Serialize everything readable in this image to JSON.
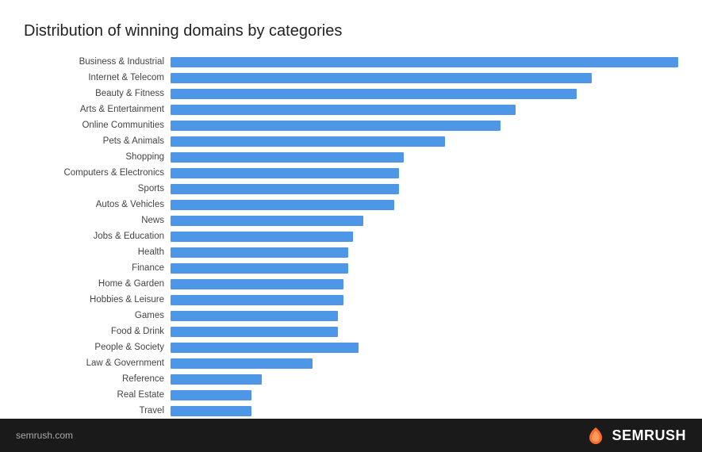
{
  "title": "Distribution of winning domains by categories",
  "footer": {
    "url": "semrush.com",
    "brand": "SEMRUSH"
  },
  "bars": [
    {
      "label": "Business & Industrial",
      "value": 100
    },
    {
      "label": "Internet & Telecom",
      "value": 83
    },
    {
      "label": "Beauty & Fitness",
      "value": 80
    },
    {
      "label": "Arts & Entertainment",
      "value": 68
    },
    {
      "label": "Online Communities",
      "value": 65
    },
    {
      "label": "Pets & Animals",
      "value": 54
    },
    {
      "label": "Shopping",
      "value": 46
    },
    {
      "label": "Computers & Electronics",
      "value": 45
    },
    {
      "label": "Sports",
      "value": 45
    },
    {
      "label": "Autos & Vehicles",
      "value": 44
    },
    {
      "label": "News",
      "value": 38
    },
    {
      "label": "Jobs & Education",
      "value": 36
    },
    {
      "label": "Health",
      "value": 35
    },
    {
      "label": "Finance",
      "value": 35
    },
    {
      "label": "Home & Garden",
      "value": 34
    },
    {
      "label": "Hobbies & Leisure",
      "value": 34
    },
    {
      "label": "Games",
      "value": 33
    },
    {
      "label": "Food & Drink",
      "value": 33
    },
    {
      "label": "People & Society",
      "value": 37
    },
    {
      "label": "Law & Government",
      "value": 28
    },
    {
      "label": "Reference",
      "value": 18
    },
    {
      "label": "Real Estate",
      "value": 16
    },
    {
      "label": "Travel",
      "value": 16
    }
  ],
  "max_value": 100,
  "bar_track_width": 640
}
